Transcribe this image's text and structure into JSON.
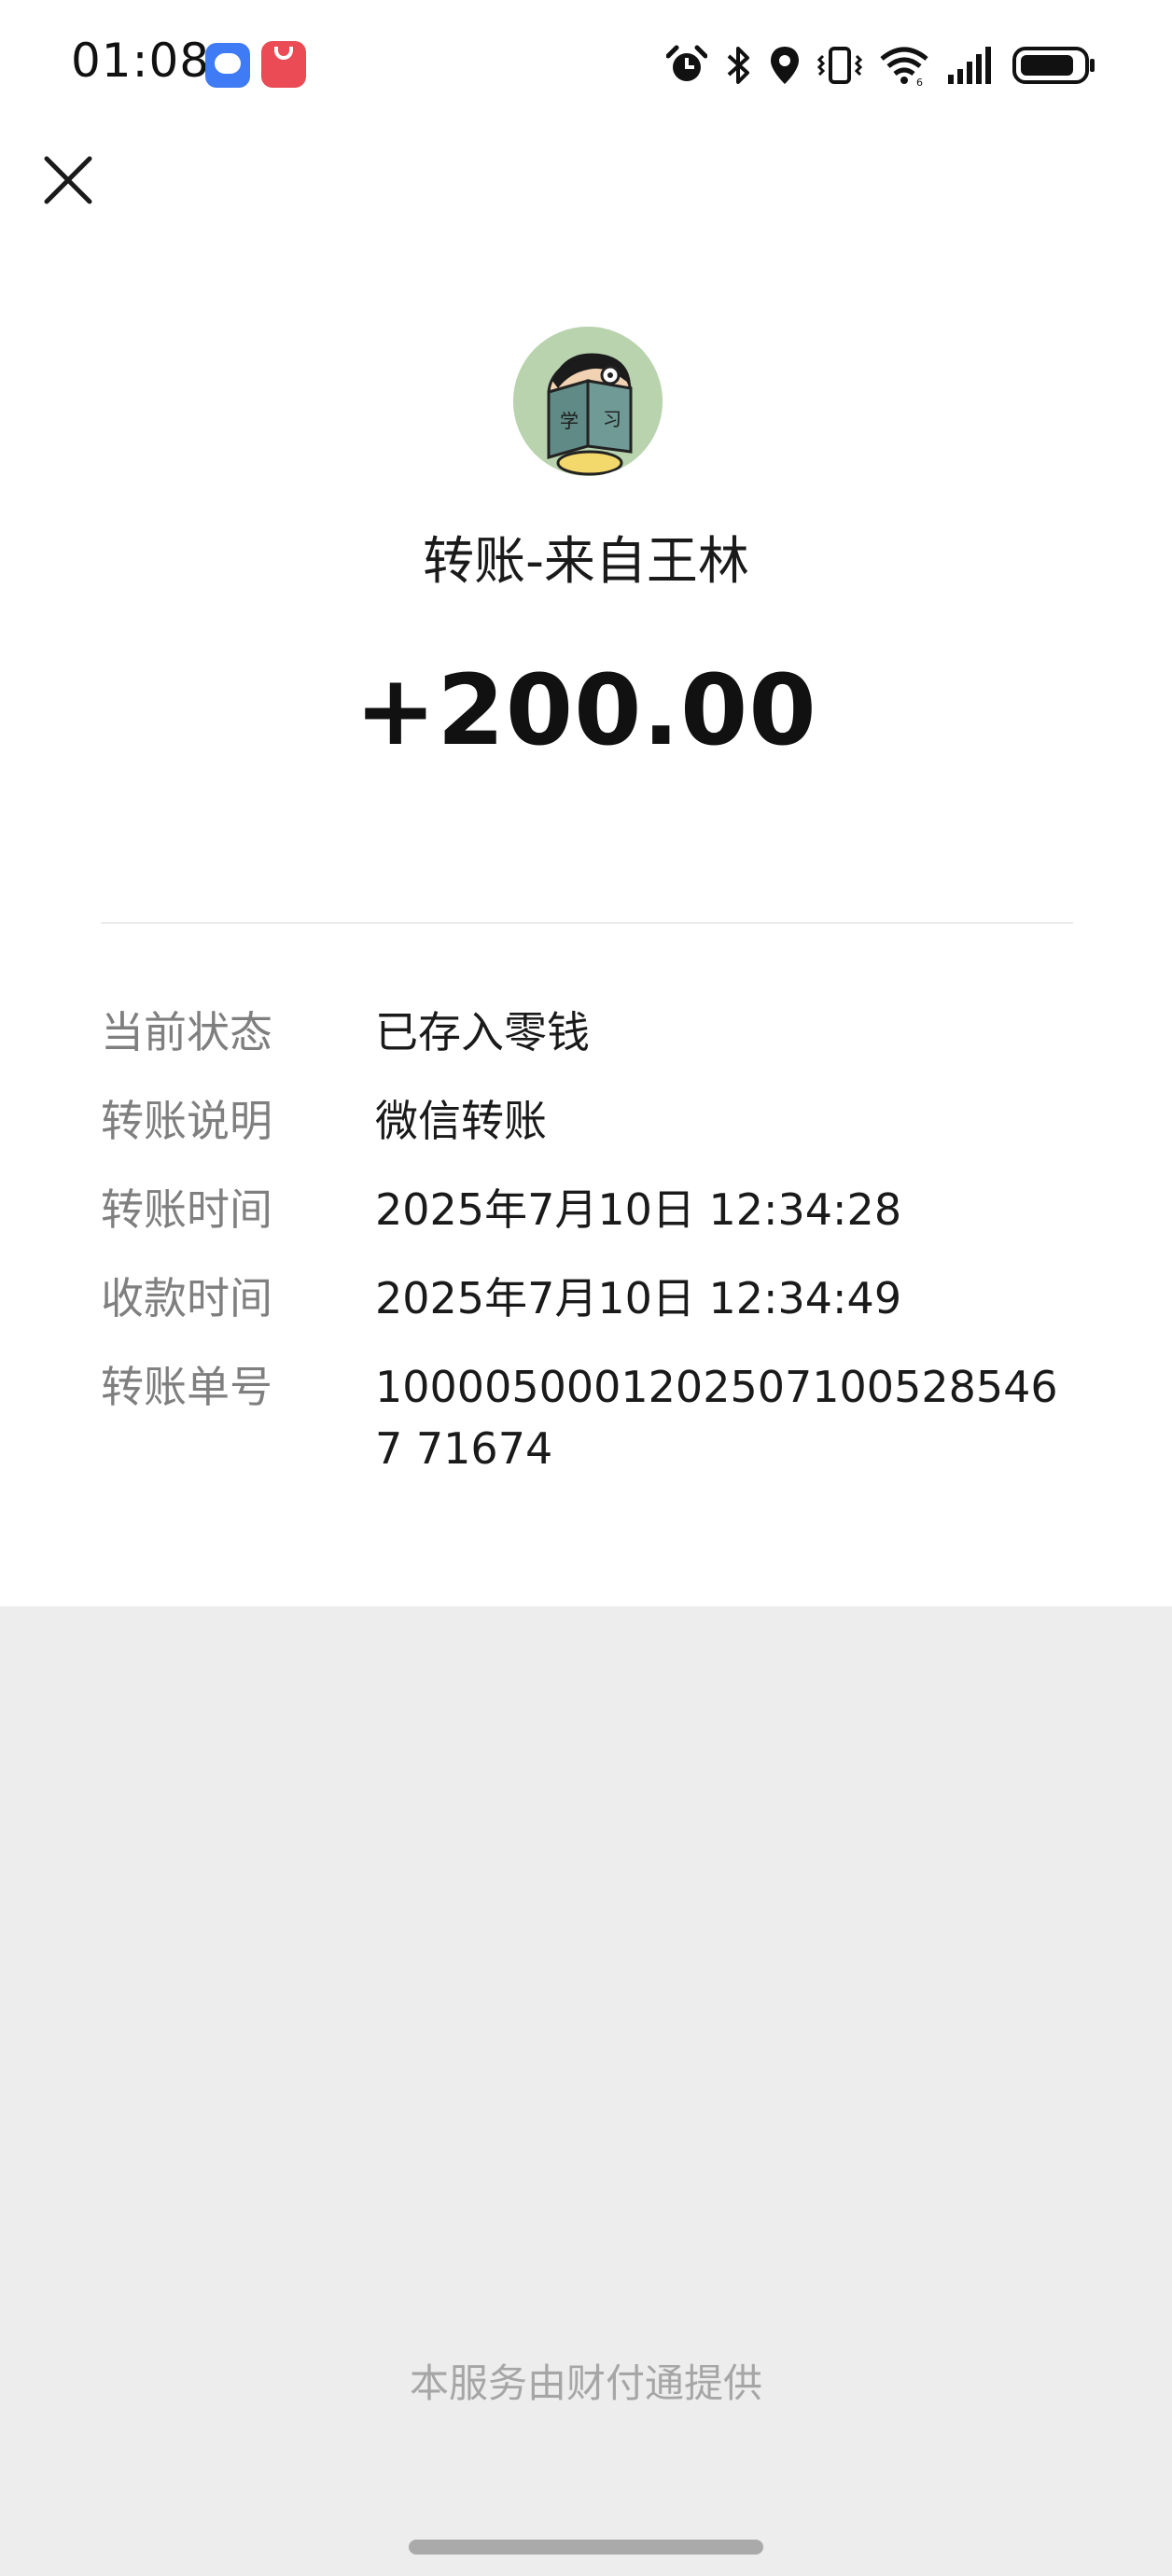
{
  "status_bar": {
    "time": "01:08",
    "notification_icons": [
      "messages-app-icon",
      "app-gallery-icon"
    ],
    "system_icons": [
      "alarm-icon",
      "bluetooth-icon",
      "location-icon",
      "vibrate-icon",
      "wifi-icon",
      "signal-icon",
      "battery-icon"
    ]
  },
  "header": {
    "title": "转账-来自王林",
    "amount": "+200.00"
  },
  "details": [
    {
      "label": "当前状态",
      "value": "已存入零钱"
    },
    {
      "label": "转账说明",
      "value": "微信转账"
    },
    {
      "label": "转账时间",
      "value": "2025年7月10日 12:34:28"
    },
    {
      "label": "收款时间",
      "value": "2025年7月10日 12:34:49"
    },
    {
      "label": "转账单号",
      "value": "10000500012025071005285467 71674"
    }
  ],
  "footer": {
    "provider_text": "本服务由财付通提供"
  }
}
